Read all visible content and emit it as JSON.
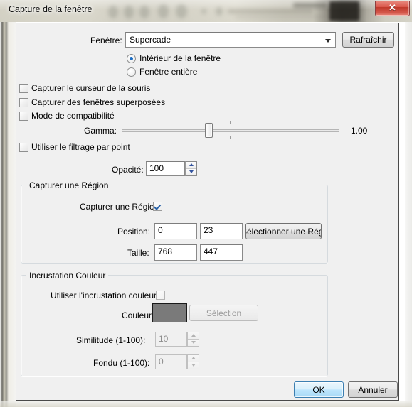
{
  "window": {
    "title": "Capture de la fenêtre",
    "close_label": "✕"
  },
  "toolbar": {
    "window_label": "Fenêtre:",
    "window_value": "Supercade",
    "refresh_label": "Rafraîchir"
  },
  "capture_mode": {
    "inner_label": "Intérieur de la fenêtre",
    "full_label": "Fenêtre entière",
    "selected": "inner"
  },
  "options": {
    "cursor_label": "Capturer le curseur de la souris",
    "cursor_checked": false,
    "overlapping_label": "Capturer des fenêtres superposées",
    "overlapping_checked": false,
    "compat_label": "Mode de compatibilité",
    "compat_checked": false,
    "point_filter_label": "Utiliser le filtrage par point",
    "point_filter_checked": false
  },
  "gamma": {
    "label": "Gamma:",
    "value": "1.00",
    "min": 0,
    "max": 2,
    "position_percent": 50
  },
  "opacity": {
    "label": "Opacité:",
    "value": "100"
  },
  "region": {
    "group_title": "Capturer une Région",
    "enable_label": "Capturer une Région",
    "enable_checked": true,
    "position_label": "Position:",
    "position_x": "0",
    "position_y": "23",
    "size_label": "Taille:",
    "size_w": "768",
    "size_h": "447",
    "select_button": "Sélectionner une Région"
  },
  "color_key": {
    "group_title": "Incrustation Couleur",
    "use_label": "Utiliser l'incrustation couleur:",
    "use_checked": false,
    "color_label": "Couleur",
    "color_value": "#7a7a7a",
    "select_button": "Sélection",
    "similarity_label": "Similitude (1-100):",
    "similarity_value": "10",
    "fade_label": "Fondu (1-100):",
    "fade_value": "0"
  },
  "footer": {
    "ok_label": "OK",
    "cancel_label": "Annuler"
  }
}
